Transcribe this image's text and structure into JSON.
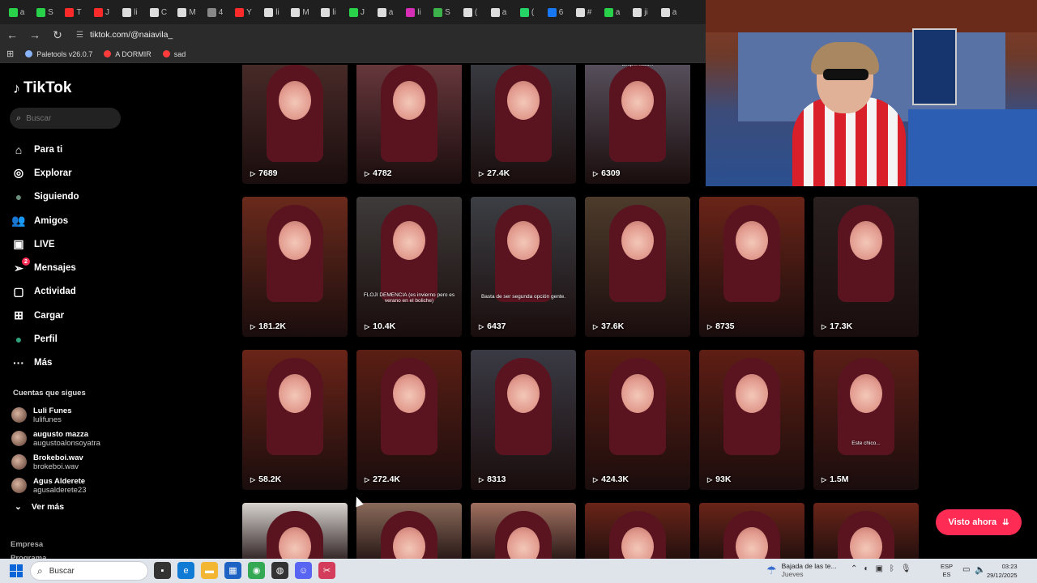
{
  "browser": {
    "tabs": [
      {
        "label": "a",
        "color": "#29d14a"
      },
      {
        "label": "S",
        "color": "#29d14a"
      },
      {
        "label": "T",
        "color": "#ff2a2a"
      },
      {
        "label": "J",
        "color": "#ff2a2a"
      },
      {
        "label": "li",
        "color": "#dddddd"
      },
      {
        "label": "C",
        "color": "#dddddd"
      },
      {
        "label": "M",
        "color": "#dddddd"
      },
      {
        "label": "4",
        "color": "#888888"
      },
      {
        "label": "Y",
        "color": "#ff2a2a"
      },
      {
        "label": "li",
        "color": "#dddddd"
      },
      {
        "label": "M",
        "color": "#dddddd"
      },
      {
        "label": "li",
        "color": "#dddddd"
      },
      {
        "label": "J",
        "color": "#29d14a"
      },
      {
        "label": "a",
        "color": "#dddddd"
      },
      {
        "label": "li",
        "color": "#d62fb5"
      },
      {
        "label": "S",
        "color": "#3cb34a"
      },
      {
        "label": "(",
        "color": "#dddddd"
      },
      {
        "label": "a",
        "color": "#dddddd"
      },
      {
        "label": "(",
        "color": "#25d366"
      },
      {
        "label": "6",
        "color": "#1877f2"
      },
      {
        "label": "#",
        "color": "#dddddd"
      },
      {
        "label": "a",
        "color": "#29d14a"
      },
      {
        "label": "ji",
        "color": "#dddddd"
      },
      {
        "label": "a",
        "color": "#dddddd"
      }
    ],
    "url": "tiktok.com/@naiavila_",
    "bookmarks": [
      {
        "label": "Paletools v26.0.7",
        "color": "#8ab4f8"
      },
      {
        "label": "A DORMIR",
        "color": "#ff3b3b"
      },
      {
        "label": "sad",
        "color": "#ff3b3b"
      }
    ]
  },
  "sidebar": {
    "logo": "TikTok",
    "search_placeholder": "Buscar",
    "nav": [
      {
        "label": "Para ti",
        "icon": "home-icon",
        "glyph": "⌂"
      },
      {
        "label": "Explorar",
        "icon": "compass-icon",
        "glyph": "◎"
      },
      {
        "label": "Siguiendo",
        "icon": "following-avatar-icon",
        "glyph": "●"
      },
      {
        "label": "Amigos",
        "icon": "friends-icon",
        "glyph": "👥"
      },
      {
        "label": "LIVE",
        "icon": "live-icon",
        "glyph": "▣"
      },
      {
        "label": "Mensajes",
        "icon": "messages-icon",
        "glyph": "➢",
        "badge": "2"
      },
      {
        "label": "Actividad",
        "icon": "activity-icon",
        "glyph": "▢"
      },
      {
        "label": "Cargar",
        "icon": "upload-icon",
        "glyph": "⊞"
      },
      {
        "label": "Perfil",
        "icon": "profile-avatar-icon",
        "glyph": "●"
      },
      {
        "label": "Más",
        "icon": "more-icon",
        "glyph": "···"
      }
    ],
    "following_title": "Cuentas que sigues",
    "following": [
      {
        "name": "Luli Funes",
        "handle": "lulifunes"
      },
      {
        "name": "augusto mazza",
        "handle": "augustoalonsoyatra"
      },
      {
        "name": "Brokeboi.wav",
        "handle": "brokeboi.wav"
      },
      {
        "name": "Agus Alderete",
        "handle": "agusalderete23"
      }
    ],
    "see_more": "Ver más",
    "footer": [
      "Empresa",
      "Programa"
    ]
  },
  "grid": {
    "rows": [
      [
        {
          "views": "7689",
          "bg": "#4a2c2a"
        },
        {
          "views": "4782",
          "bg": "#6b3a3f"
        },
        {
          "views": "27.4K",
          "bg": "#3a3d44"
        },
        {
          "views": "6309",
          "bg": "#5a5360",
          "caption": "despeinada...",
          "capTop": 6
        }
      ],
      [
        {
          "views": "181.2K",
          "bg": "#6a2a1c"
        },
        {
          "views": "10.4K",
          "bg": "#3e3b3a",
          "caption": "FLOJI DEMENCIA (es invierno pero es verano en el boliche)",
          "capTop": 118
        },
        {
          "views": "6437",
          "bg": "#3c3f44",
          "caption": "Basta de ser segunda opción gente.",
          "capTop": 120
        },
        {
          "views": "37.6K",
          "bg": "#4d3b2b"
        },
        {
          "views": "8735",
          "bg": "#6a2418"
        },
        {
          "views": "17.3K",
          "bg": "#2a2020"
        }
      ],
      [
        {
          "views": "58.2K",
          "bg": "#6a2418"
        },
        {
          "views": "272.4K",
          "bg": "#5a1e14"
        },
        {
          "views": "8313",
          "bg": "#3a3a44"
        },
        {
          "views": "424.3K",
          "bg": "#5e1e14"
        },
        {
          "views": "93K",
          "bg": "#5e1e14"
        },
        {
          "views": "1.5M",
          "bg": "#5a1e16",
          "caption": "Este chico...",
          "capTop": 112
        }
      ],
      [
        {
          "views": "",
          "bg": "#d9d4d0"
        },
        {
          "views": "",
          "bg": "#8a6a5a"
        },
        {
          "views": "",
          "bg": "#a07060"
        },
        {
          "views": "",
          "bg": "#6a2418"
        },
        {
          "views": "",
          "bg": "#6a2418"
        },
        {
          "views": "",
          "bg": "#6a2418"
        }
      ]
    ]
  },
  "floating_button": "Visto ahora",
  "taskbar": {
    "search_placeholder": "Buscar",
    "apps": [
      {
        "icon": "task-view-icon",
        "color": "#333333",
        "glyph": "▪"
      },
      {
        "icon": "edge-icon",
        "color": "#0f7bd4",
        "glyph": "e"
      },
      {
        "icon": "file-explorer-icon",
        "color": "#f2b632",
        "glyph": "▬"
      },
      {
        "icon": "store-icon",
        "color": "#1e63c4",
        "glyph": "▦"
      },
      {
        "icon": "chrome-icon",
        "color": "#34a853",
        "glyph": "◉"
      },
      {
        "icon": "obs-icon",
        "color": "#333333",
        "glyph": "◍"
      },
      {
        "icon": "discord-icon",
        "color": "#5865f2",
        "glyph": "☺"
      },
      {
        "icon": "snipping-tool-icon",
        "color": "#d33c5a",
        "glyph": "✂"
      }
    ],
    "weather_line1": "Bajada de las te...",
    "weather_line2": "Jueves",
    "lang_line1": "ESP",
    "lang_line2": "ES",
    "time": "03:23",
    "date": "29/12/2025"
  }
}
